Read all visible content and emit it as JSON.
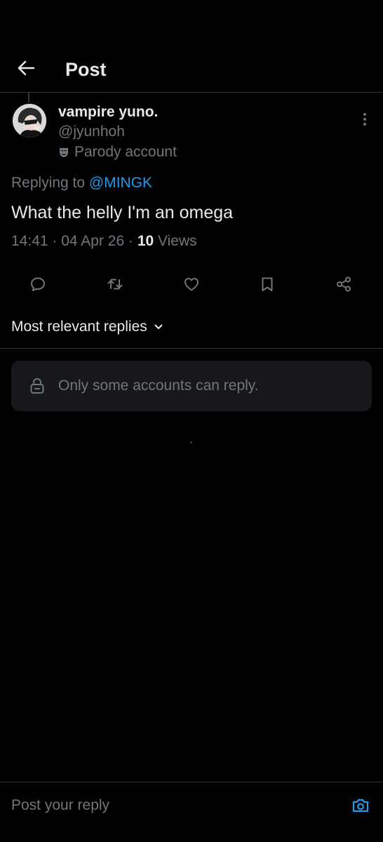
{
  "header": {
    "title": "Post"
  },
  "post": {
    "display_name": "vampire yuno.",
    "handle": "@jyunhoh",
    "badge_label": "Parody account",
    "replying_prefix": "Replying to",
    "replying_to": "@MINGK",
    "text": "What the helly I'm an omega",
    "time": "14:41",
    "date": "04 Apr 26",
    "views_count": "10",
    "views_label": "Views"
  },
  "actions": [
    "reply-icon",
    "repost-icon",
    "like-icon",
    "bookmark-icon",
    "share-icon"
  ],
  "replies": {
    "sort_label": "Most relevant replies",
    "restricted_notice": "Only some accounts can reply."
  },
  "composer": {
    "placeholder": "Post your reply"
  },
  "colors": {
    "background": "#000000",
    "accent": "#1d9bf0",
    "muted": "#71767b",
    "text": "#e7e9ea",
    "divider": "#2f3336"
  }
}
